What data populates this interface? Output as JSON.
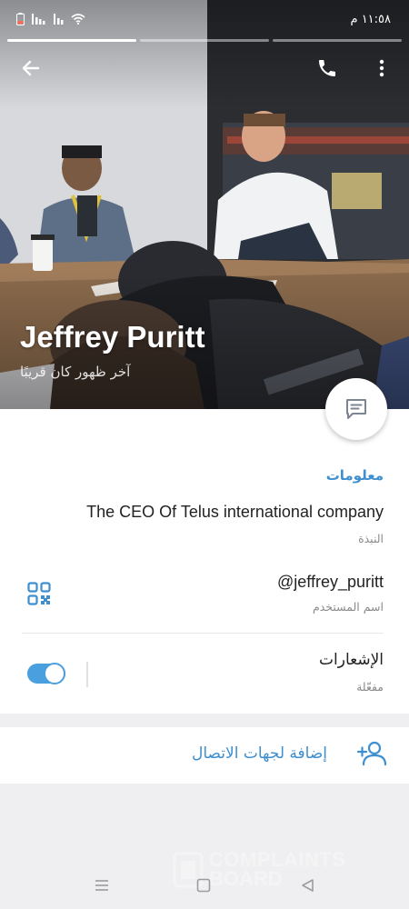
{
  "status_bar": {
    "time": "١١:٥٨ م",
    "icons": [
      "battery-icon",
      "signal-icon",
      "signal-icon",
      "wifi-icon"
    ]
  },
  "story_progress": [
    1,
    0,
    0
  ],
  "header": {
    "name": "Jeffrey Puritt",
    "last_seen": "آخر ظهور كان قريبًا",
    "actions": [
      "back-arrow-icon",
      "phone-icon",
      "more-vertical-icon"
    ],
    "fab_icon": "message-icon"
  },
  "info": {
    "section_title": "معلومات",
    "bio": "The CEO Of Telus international company",
    "bio_label": "النبذة",
    "username": "@jeffrey_puritt",
    "username_label": "اسم المستخدم",
    "notifications": "الإشعارات",
    "notifications_status": "مفعّلة",
    "notifications_enabled": true
  },
  "add_contact": {
    "label": "إضافة لجهات الاتصال",
    "icon": "add-person-icon"
  },
  "watermark": {
    "line1": "COMPLAINTS",
    "line2": "BOARD"
  },
  "colors": {
    "accent": "#3d8fd0",
    "toggle": "#4a9fde",
    "background": "#efeff1"
  }
}
